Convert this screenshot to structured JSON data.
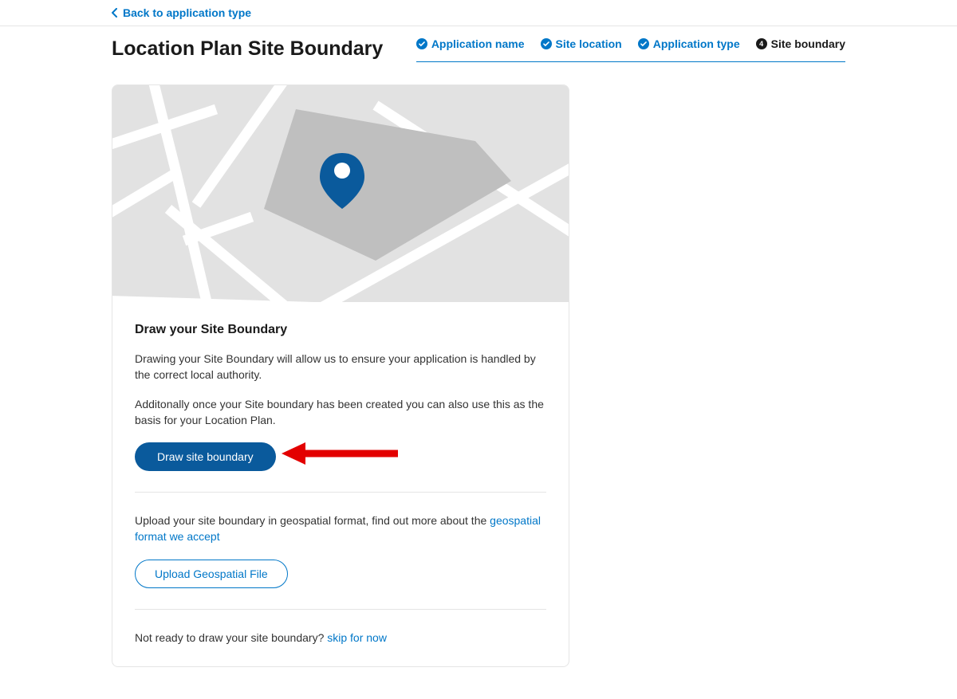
{
  "back": {
    "label": "Back to application type"
  },
  "title": "Location Plan Site Boundary",
  "steps": [
    {
      "label": "Application name",
      "done": true
    },
    {
      "label": "Site location",
      "done": true
    },
    {
      "label": "Application type",
      "done": true
    },
    {
      "label": "Site boundary",
      "active": true,
      "number": "4"
    }
  ],
  "card": {
    "section_title": "Draw your Site Boundary",
    "para1": "Drawing your Site Boundary will allow us to ensure your application is handled by the correct local authority.",
    "para2": "Additonally once your Site boundary has been created you can also use this as the basis for your Location Plan.",
    "draw_button": "Draw site boundary",
    "upload_intro": "Upload your site boundary in geospatial format, find out more about the ",
    "upload_link": "geospatial format we accept",
    "upload_button": "Upload Geospatial File",
    "skip_intro": "Not ready to draw your site boundary? ",
    "skip_link": "skip for now"
  },
  "colors": {
    "brand": "#0077c8",
    "button": "#0a5a9c",
    "annotation": "#e30000"
  }
}
